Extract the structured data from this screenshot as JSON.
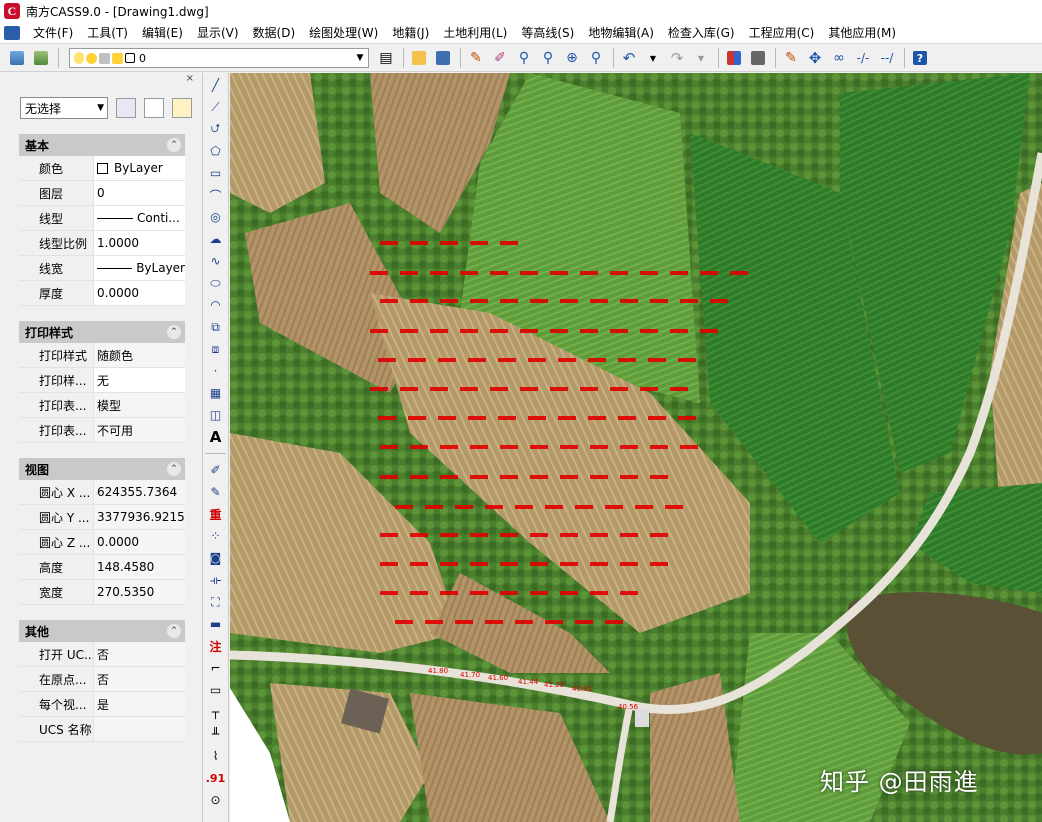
{
  "window": {
    "title": "南方CASS9.0 - [Drawing1.dwg]"
  },
  "menu": [
    "文件(F)",
    "工具(T)",
    "编辑(E)",
    "显示(V)",
    "数据(D)",
    "绘图处理(W)",
    "地籍(J)",
    "土地利用(L)",
    "等高线(S)",
    "地物编辑(A)",
    "检查入库(G)",
    "工程应用(C)",
    "其他应用(M)"
  ],
  "toolbar": {
    "layer_value": "0"
  },
  "properties": {
    "selection": "无选择",
    "sections": {
      "basic": {
        "title": "基本",
        "rows": [
          {
            "k": "颜色",
            "v": "ByLayer"
          },
          {
            "k": "图层",
            "v": "0"
          },
          {
            "k": "线型",
            "v": "Conti..."
          },
          {
            "k": "线型比例",
            "v": "1.0000"
          },
          {
            "k": "线宽",
            "v": "ByLayer"
          },
          {
            "k": "厚度",
            "v": "0.0000"
          }
        ]
      },
      "plot": {
        "title": "打印样式",
        "rows": [
          {
            "k": "打印样式",
            "v": "随颜色"
          },
          {
            "k": "打印样...",
            "v": "无"
          },
          {
            "k": "打印表...",
            "v": "模型"
          },
          {
            "k": "打印表...",
            "v": "不可用"
          }
        ]
      },
      "view": {
        "title": "视图",
        "rows": [
          {
            "k": "圆心 X ...",
            "v": "624355.7364"
          },
          {
            "k": "圆心 Y ...",
            "v": "3377936.9215"
          },
          {
            "k": "圆心 Z ...",
            "v": "0.0000"
          },
          {
            "k": "高度",
            "v": "148.4580"
          },
          {
            "k": "宽度",
            "v": "270.5350"
          }
        ]
      },
      "other": {
        "title": "其他",
        "rows": [
          {
            "k": "打开 UC...",
            "v": "否"
          },
          {
            "k": "在原点...",
            "v": "否"
          },
          {
            "k": "每个视...",
            "v": "是"
          },
          {
            "k": "UCS 名称",
            "v": ""
          }
        ]
      }
    }
  },
  "tools": {
    "text_tool": "A",
    "zhong": "重",
    "zhu": "注",
    "point_label": ".91"
  },
  "watermark": "知乎 @田雨進",
  "road_labels": [
    "41.80",
    "41.70",
    "41.60",
    "41.44",
    "41.23",
    "40.81",
    "40.56"
  ],
  "colors": {
    "title_red": "#c8102e",
    "point_red": "#e00000",
    "section_bg": "#c9c9c9"
  }
}
